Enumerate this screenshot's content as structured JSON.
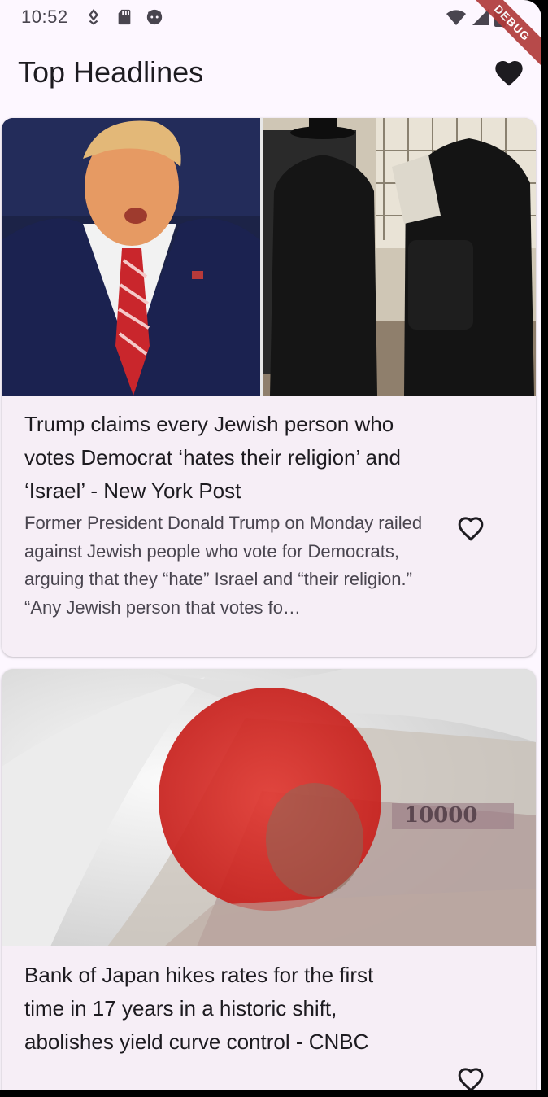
{
  "status_bar": {
    "time": "10:52",
    "icons": [
      "location-icon",
      "sd-card-icon",
      "android-icon",
      "wifi-icon",
      "signal-icon",
      "battery-icon"
    ]
  },
  "debug_banner": {
    "label": "DEBUG",
    "color": "#b13b3b"
  },
  "app_bar": {
    "title": "Top Headlines",
    "favorites_icon": "heart-filled-icon"
  },
  "articles": [
    {
      "title": "Trump claims every Jewish person who votes Democrat ‘hates their religion’ and ‘Israel’ - New York Post",
      "description": "Former President Donald Trump on Monday railed against Jewish people who vote for Democrats, arguing that they “hate” Israel and “their religion.” “Any Jewish person that votes fo…",
      "image": "news-photo",
      "like_icon": "heart-outline-icon"
    },
    {
      "title": "Bank of Japan hikes rates for the first time in 17 years in a historic shift, abolishes yield curve control - CNBC",
      "description": "",
      "image": "news-photo",
      "like_icon": "heart-outline-icon"
    }
  ],
  "colors": {
    "background": "#fdf7ff",
    "card": "#f6eef6",
    "text_primary": "#1d1b20",
    "text_secondary": "#49454f"
  }
}
